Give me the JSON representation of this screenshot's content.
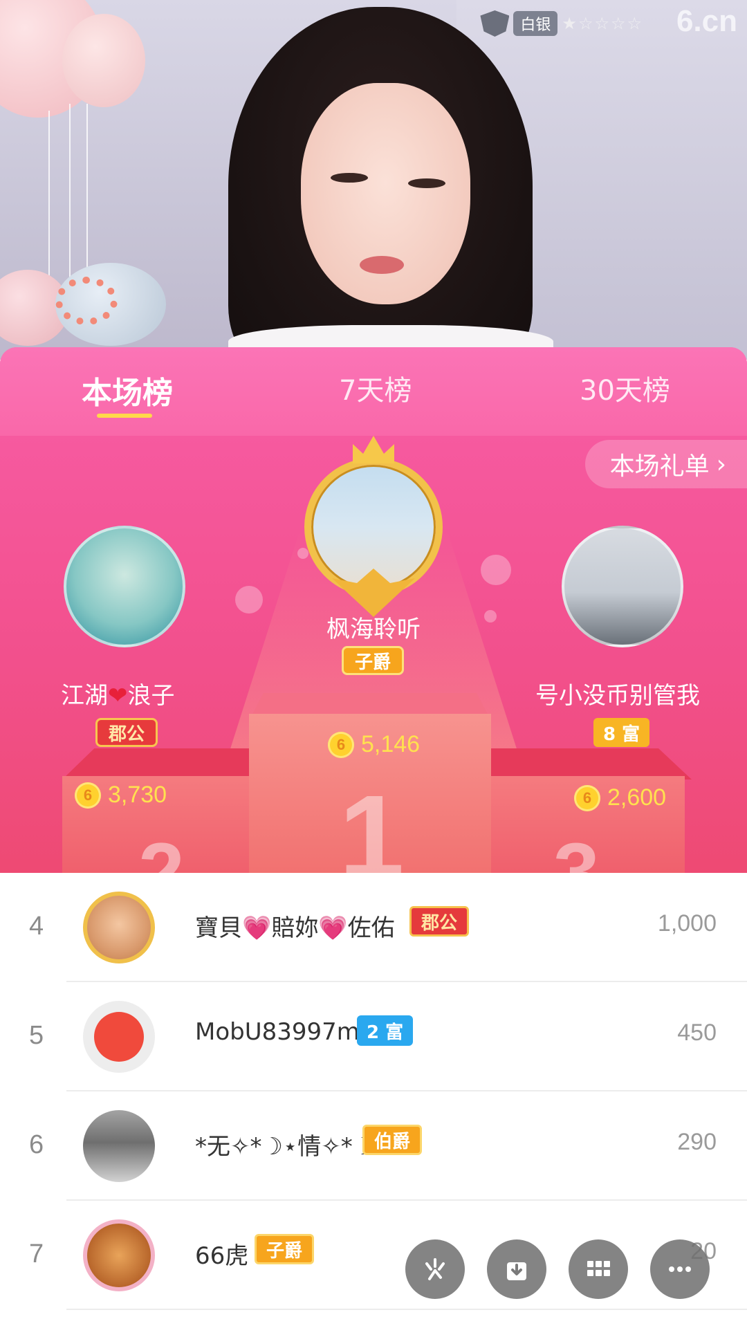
{
  "video": {
    "tier_label": "白银",
    "stars": "★☆☆☆☆",
    "logo": "6.cn"
  },
  "tabs": [
    {
      "label": "本场榜",
      "active": true
    },
    {
      "label": "7天榜",
      "active": false
    },
    {
      "label": "30天榜",
      "active": false
    }
  ],
  "gift_list_button": {
    "label": "本场礼单",
    "icon": "chevron-right-icon"
  },
  "podium": {
    "first": {
      "rank_mark": "1",
      "name": "枫海聆听",
      "noble": "子爵",
      "coins": "5,146"
    },
    "second": {
      "rank_mark": "2",
      "name_left": "江湖",
      "name_right": "浪子",
      "noble": "郡公",
      "coins": "3,730"
    },
    "third": {
      "rank_mark": "3",
      "name": "号小没币别管我",
      "wealth": "8 富",
      "coins": "2,600"
    }
  },
  "coin_glyph": "6",
  "list": [
    {
      "rank": "4",
      "name": "寶貝💗賠妳💗佐佑",
      "badge": "郡公",
      "badge_style": "red",
      "score": "1,000"
    },
    {
      "rank": "5",
      "name": "MobU83997m",
      "badge": "2 富",
      "badge_style": "blue",
      "score": "450"
    },
    {
      "rank": "6",
      "name": "*无✧*☽⋆情✧*☽",
      "badge": "伯爵",
      "badge_style": "orange",
      "score": "290"
    },
    {
      "rank": "7",
      "name": "66虎",
      "badge": "子爵",
      "badge_style": "orange",
      "score": "20"
    }
  ],
  "fabs": [
    {
      "icon": "sparkle-icon"
    },
    {
      "icon": "download-icon"
    },
    {
      "icon": "grid-icon"
    },
    {
      "icon": "more-icon"
    }
  ],
  "colors": {
    "panel_pink": "#f65aa0",
    "tab_underline": "#ffd84a",
    "coin_yellow": "#ffe14f",
    "wealth_orange": "#f8b524",
    "wealth_blue": "#2aa8ef"
  }
}
